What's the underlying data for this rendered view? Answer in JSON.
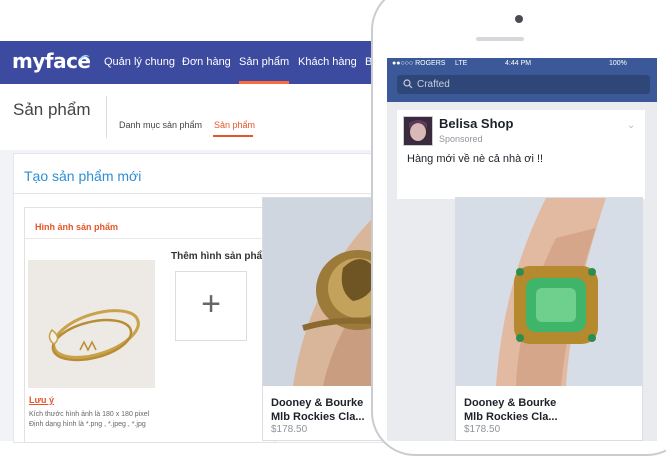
{
  "admin": {
    "logo": "myface",
    "nav": [
      {
        "label": "Quản lý chung",
        "active": false
      },
      {
        "label": "Đơn hàng",
        "active": false
      },
      {
        "label": "Sản phẩm",
        "active": true
      },
      {
        "label": "Khách hàng",
        "active": false
      },
      {
        "label": "Bá",
        "active": false
      }
    ],
    "page_title": "Sản phẩm",
    "subtabs": [
      {
        "label": "Danh mục sản phẩm",
        "active": false
      },
      {
        "label": "Sản phẩm",
        "active": true
      }
    ],
    "card_title": "Tạo sản phẩm mới",
    "image_panel": {
      "title": "Hình ảnh sản phẩm",
      "more_images_label": "Thêm hình sản phẩm",
      "add_button_glyph": "+",
      "note_title": "Lưu ý",
      "note_text": "Kích thước hình ảnh là 180 x 180 pixel Định dạng hình là *.png , *.jpeg , *.jpg"
    }
  },
  "phone": {
    "status": {
      "carrier": "●●○○○ ROGERS",
      "network": "LTE",
      "time": "4:44 PM",
      "battery": "100%"
    },
    "search_placeholder": "Crafted",
    "post": {
      "shop_name": "Belisa Shop",
      "sponsored": "Sponsored",
      "text": "Hàng mới về nè cả nhà ơi !!"
    }
  },
  "ads": [
    {
      "name_line1": "Dooney & Bourke",
      "name_line2": "Mlb Rockies Cla...",
      "price": "$178.50",
      "gem_color": "#8a6a2e"
    },
    {
      "name_line1": "Dooney & Bourke",
      "name_line2": "Mlb Rockies Cla...",
      "price": "$178.50",
      "gem_color": "#3fb56a"
    }
  ],
  "colors": {
    "admin_bar": "#3c4aa0",
    "accent": "#e4562a",
    "link": "#2d8fd5",
    "facebook": "#3b5998"
  }
}
